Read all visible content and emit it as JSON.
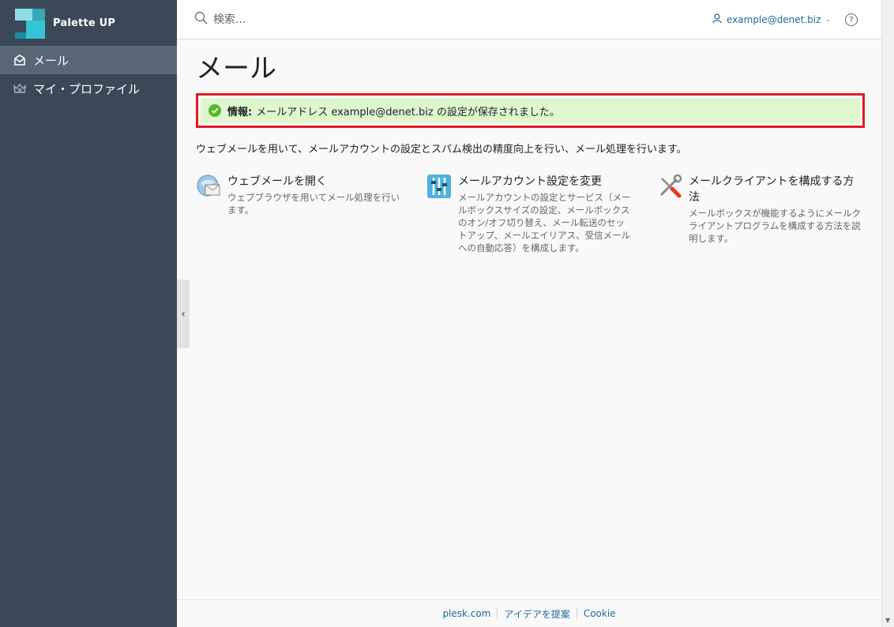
{
  "brand": {
    "name": "Palette UP"
  },
  "sidebar": {
    "items": [
      {
        "label": "メール",
        "icon": "mail-icon",
        "active": true
      },
      {
        "label": "マイ・プロファイル",
        "icon": "profile-crown-icon",
        "active": false
      }
    ]
  },
  "header": {
    "search_placeholder": "検索...",
    "user": "example@denet.biz",
    "help": "?"
  },
  "page": {
    "title": "メール",
    "alert_label": "情報:",
    "alert_text": "メールアドレス example@denet.biz の設定が保存されました。",
    "intro": "ウェブメールを用いて、メールアカウントの設定とスパム検出の精度向上を行い、メール処理を行います。"
  },
  "cards": [
    {
      "title": "ウェブメールを開く",
      "desc": "ウェブブラウザを用いてメール処理を行います。",
      "icon": "webmail-icon"
    },
    {
      "title": "メールアカウント設定を変更",
      "desc": "メールアカウントの設定とサービス（メールボックスサイズの設定、メールボックスのオン/オフ切り替え、メール転送のセットアップ、メールエイリアス、受信メールへの自動応答）を構成します。",
      "icon": "settings-sliders-icon"
    },
    {
      "title": "メールクライアントを構成する方法",
      "desc": "メールボックスが機能するようにメールクライアントプログラムを構成する方法を説明します。",
      "icon": "tools-icon"
    }
  ],
  "footer": {
    "links": [
      "plesk.com",
      "アイデアを提案",
      "Cookie"
    ]
  },
  "colors": {
    "sidebar_bg": "#3b4858",
    "sidebar_active": "#586676",
    "alert_bg": "#dff7cf",
    "alert_border": "#e11b22",
    "link": "#1b6a9a",
    "success": "#5ab82b"
  }
}
